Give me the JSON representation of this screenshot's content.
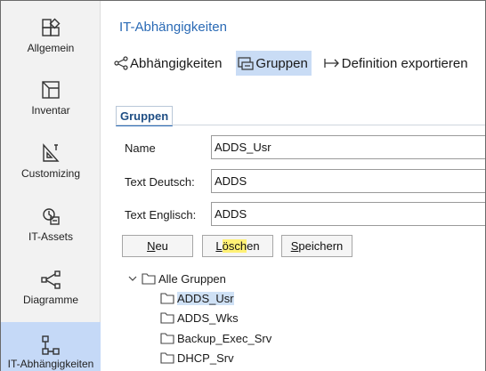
{
  "sidebar": {
    "items": [
      {
        "label": "Allgemein",
        "icon": "puzzle-icon"
      },
      {
        "label": "Inventar",
        "icon": "inventory-icon"
      },
      {
        "label": "Customizing",
        "icon": "customizing-icon"
      },
      {
        "label": "IT-Assets",
        "icon": "it-assets-icon"
      },
      {
        "label": "Diagramme",
        "icon": "diagram-icon"
      },
      {
        "label": "IT-Abhängigkeiten",
        "icon": "dependency-icon",
        "active": true
      }
    ]
  },
  "main": {
    "title": "IT-Abhängigkeiten",
    "toolbar": {
      "dependencies": "Abhängigkeiten",
      "groups": "Gruppen",
      "export": "Definition exportieren"
    },
    "tab_label": "Gruppen",
    "form": {
      "name_label": "Name",
      "name_value": "ADDS_Usr",
      "text_de_label": "Text Deutsch:",
      "text_de_value": "ADDS",
      "text_en_label": "Text Englisch:",
      "text_en_value": "ADDS"
    },
    "buttons": {
      "new_ul": "N",
      "new_rest": "eu",
      "delete_pre": "L",
      "delete_hl": "ösch",
      "delete_post": "en",
      "save_ul": "S",
      "save_rest": "peichern"
    },
    "tree": {
      "root": "Alle Gruppen",
      "children": [
        "ADDS_Usr",
        "ADDS_Wks",
        "Backup_Exec_Srv",
        "DHCP_Srv"
      ]
    }
  },
  "colors": {
    "accent": "#2a6ab5",
    "active_nav": "#c5d9f7",
    "highlight": "#fff176"
  }
}
